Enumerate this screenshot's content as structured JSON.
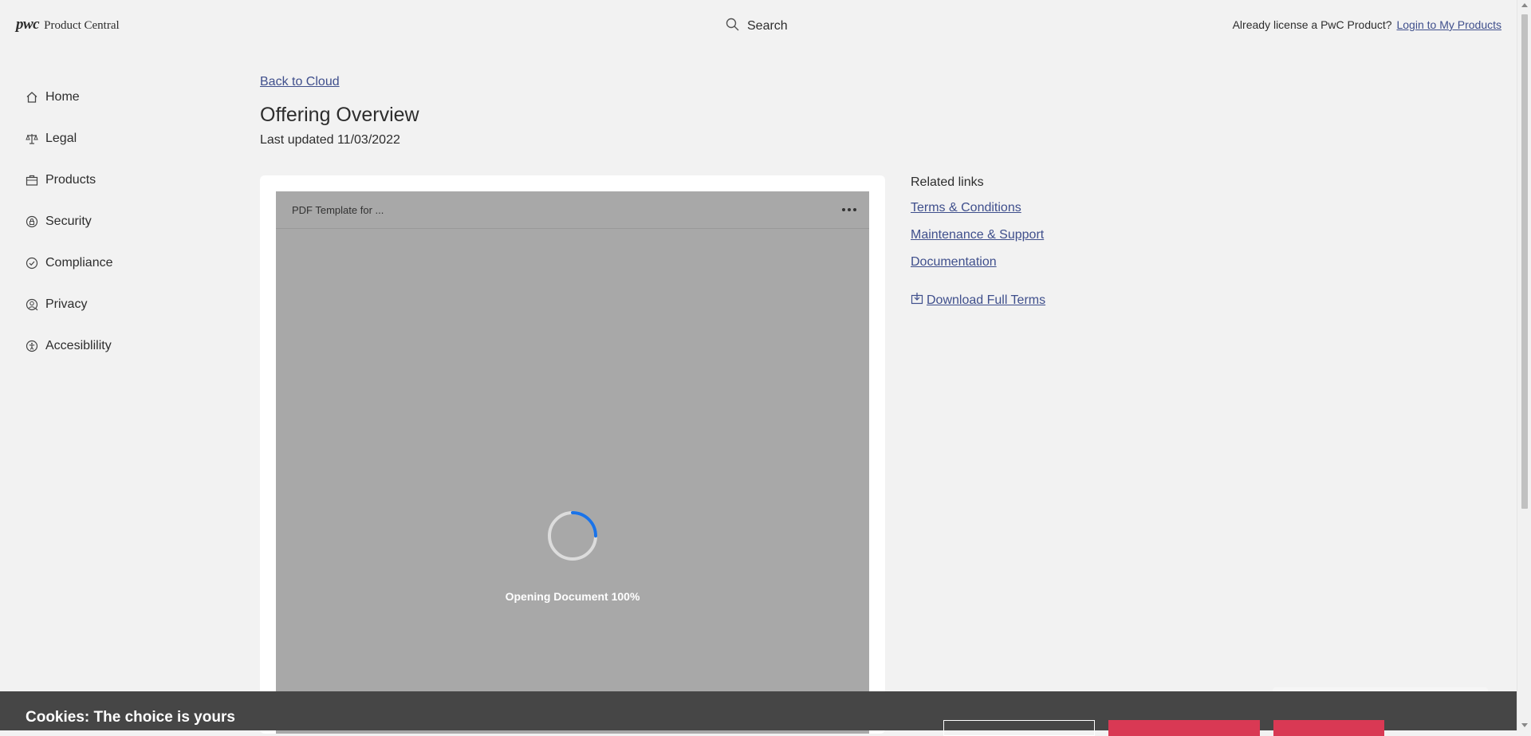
{
  "header": {
    "logo_mark": "pwc",
    "logo_text": "Product Central",
    "search_label": "Search",
    "license_text": "Already license a PwC Product?",
    "login_link": "Login to My Products"
  },
  "sidebar": {
    "items": [
      {
        "label": "Home",
        "icon": "home-icon"
      },
      {
        "label": "Legal",
        "icon": "scales-icon"
      },
      {
        "label": "Products",
        "icon": "briefcase-icon"
      },
      {
        "label": "Security",
        "icon": "lock-icon"
      },
      {
        "label": "Compliance",
        "icon": "check-circle-icon"
      },
      {
        "label": "Privacy",
        "icon": "privacy-user-icon"
      },
      {
        "label": "Accesiblility",
        "icon": "accessibility-icon"
      }
    ]
  },
  "main": {
    "back_link": "Back to Cloud",
    "title": "Offering Overview",
    "updated": "Last updated 11/03/2022",
    "viewer": {
      "doc_title": "PDF Template for ...",
      "loading_text": "Opening Document 100%",
      "progress": 0.25
    }
  },
  "related": {
    "title": "Related links",
    "links": [
      "Terms & Conditions",
      "Maintenance & Support",
      "Documentation"
    ],
    "download": "Download Full Terms"
  },
  "cookie": {
    "title": "Cookies: The choice is yours"
  },
  "colors": {
    "link": "#3f4f8c",
    "accent": "#d93954",
    "spinner": "#1a73e8",
    "banner": "#464646"
  }
}
